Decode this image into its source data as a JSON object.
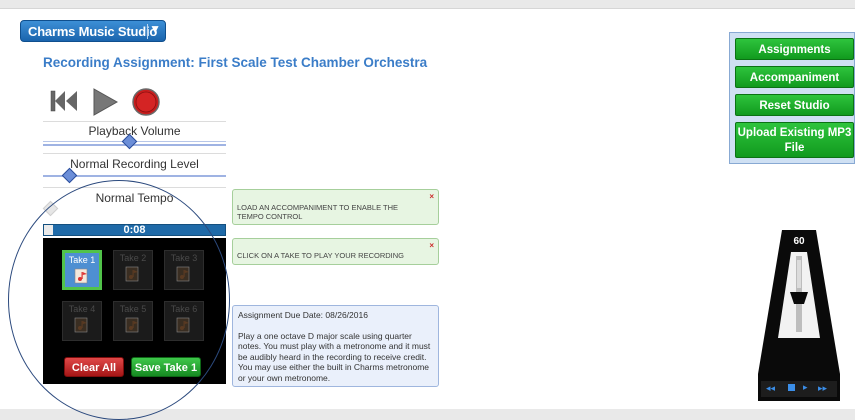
{
  "header": {
    "studio_button": "Charms Music Studio",
    "studio_caret": "▼"
  },
  "assignment": {
    "title": "Recording Assignment: First Scale Test Chamber Orchestra"
  },
  "transport": {
    "icons": [
      "rewind-icon",
      "play-icon",
      "record-icon"
    ],
    "record_color": "#c81d1d"
  },
  "sliders": {
    "playback_volume": {
      "label": "Playback Volume",
      "value": 0.47
    },
    "recording_level": {
      "label": "Normal Recording Level",
      "value": 0.14
    },
    "tempo": {
      "label": "Normal Tempo",
      "value": 0.0
    }
  },
  "progress": {
    "time": "0:08",
    "value": 0.05
  },
  "takes": [
    {
      "label": "Take 1",
      "active": true
    },
    {
      "label": "Take 2",
      "active": false
    },
    {
      "label": "Take 3",
      "active": false
    },
    {
      "label": "Take 4",
      "active": false
    },
    {
      "label": "Take 5",
      "active": false
    },
    {
      "label": "Take 6",
      "active": false
    }
  ],
  "panel_buttons": {
    "clear": "Clear All",
    "save": "Save Take 1"
  },
  "notices": [
    {
      "text": "LOAD AN ACCOMPANIMENT TO ENABLE THE TEMPO CONTROL",
      "close": "×"
    },
    {
      "text": "CLICK ON A TAKE TO PLAY YOUR RECORDING",
      "close": "×"
    }
  ],
  "due": {
    "date": "Assignment Due Date: 08/26/2016",
    "description": "Play a one octave D major scale using quarter notes. You must play with a metronome and it must be audibly heard in the recording to receive credit. You may use either the built in Charms metronome or your own metronome."
  },
  "side_buttons": [
    "Assignments",
    "Accompaniment",
    "Reset Studio",
    "Upload Existing MP3 File"
  ],
  "metronome": {
    "bpm": "60"
  },
  "colors": {
    "accent": "#3b7dc8",
    "green": "#1aab29",
    "red": "#c81d1d"
  }
}
